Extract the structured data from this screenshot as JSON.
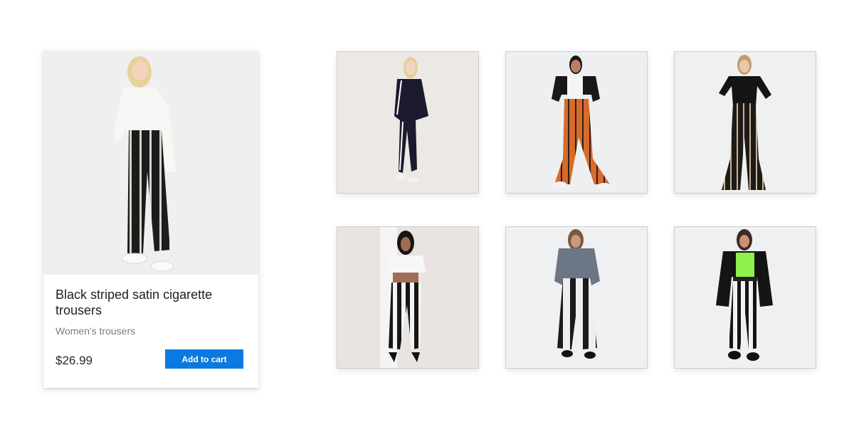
{
  "product_card": {
    "title": "Black striped satin cigarette trousers",
    "category": "Women's trousers",
    "price": "$26.99",
    "add_to_cart_label": "Add to cart",
    "accent_color": "#0a7ae0"
  },
  "thumbnails": [
    {
      "name": "thumbnail-1"
    },
    {
      "name": "thumbnail-2"
    },
    {
      "name": "thumbnail-3"
    },
    {
      "name": "thumbnail-4"
    },
    {
      "name": "thumbnail-5"
    },
    {
      "name": "thumbnail-6"
    }
  ]
}
